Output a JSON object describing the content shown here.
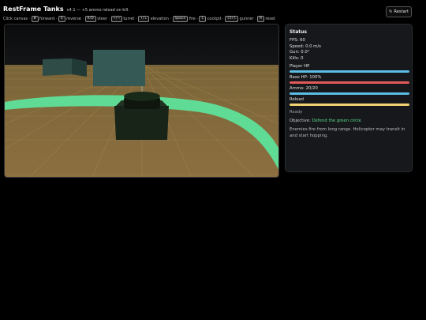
{
  "app": {
    "title": "RestFrame Tanks",
    "version": "v4.1 — +5 ammo reload on kill."
  },
  "help": {
    "prefix": "Click canvas ·",
    "controls": [
      {
        "key": "W",
        "action": "forward ·"
      },
      {
        "key": "S",
        "action": "reverse ·"
      },
      {
        "key": "A/D",
        "action": "steer ·"
      },
      {
        "key": "←/→",
        "action": "turret ·"
      },
      {
        "key": "↑/↓",
        "action": "elevation ·"
      },
      {
        "key": "Space",
        "action": "fire ·"
      },
      {
        "key": "C",
        "action": "cockpit ·"
      },
      {
        "key": "Ctrl",
        "action": "gunner ·"
      },
      {
        "key": "R",
        "action": "reset"
      }
    ]
  },
  "toolbar": {
    "restart_icon": "↻",
    "restart_label": "Restart"
  },
  "status": {
    "title": "Status",
    "fps": "FPS: 60",
    "speed": "Speed: 0.0 m/s",
    "gun": "Gun: 0.0°",
    "kills": "Kills: 0",
    "player_hp_label": "Player HP",
    "player_hp_fraction": 1.0,
    "player_hp_color": "#5bbce4",
    "base_hp_label": "Base HP: 100%",
    "base_hp_fraction": 1.0,
    "base_hp_color": "#e05a5a",
    "ammo_label": "Ammo: 20/20",
    "ammo_fraction": 1.0,
    "ammo_color": "#5bbce4",
    "reload_label": "Reload",
    "reload_fraction": 1.0,
    "reload_color": "#f2d173",
    "ready_text": "Ready",
    "objective_prefix": "Objective:",
    "objective_value": "Defend the green circle",
    "objective_color": "#5ee28f",
    "hint": "Enemies fire from long range. Helicopter may transit in and start hopping."
  }
}
